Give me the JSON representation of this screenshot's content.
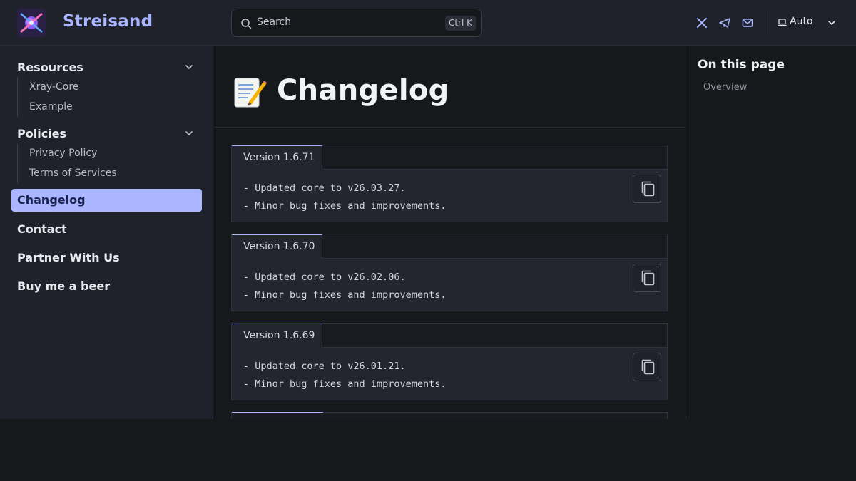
{
  "header": {
    "site_title": "Streisand",
    "search": {
      "placeholder": "Search",
      "shortcut": "Ctrl K"
    },
    "social_icons": [
      "x-icon",
      "telegram-icon",
      "mail-icon"
    ],
    "theme": {
      "label": "Auto",
      "icon": "laptop-icon"
    }
  },
  "sidebar": {
    "groups": [
      {
        "title": "Resources",
        "items": [
          "Xray-Core",
          "Example"
        ]
      },
      {
        "title": "Policies",
        "items": [
          "Privacy Policy",
          "Terms of Services"
        ]
      }
    ],
    "active_item": "Changelog",
    "items": [
      "Contact",
      "Partner With Us",
      "Buy me a beer"
    ]
  },
  "main": {
    "title": "Changelog",
    "title_emoji": "memo-icon",
    "entries": [
      {
        "version": "Version 1.6.71",
        "lines": [
          "- Updated core to v26.03.27.",
          "- Minor bug fixes and improvements."
        ]
      },
      {
        "version": "Version 1.6.70",
        "lines": [
          "- Updated core to v26.02.06.",
          "- Minor bug fixes and improvements."
        ]
      },
      {
        "version": "Version 1.6.69",
        "lines": [
          "- Updated core to v26.01.21.",
          "- Minor bug fixes and improvements."
        ]
      }
    ]
  },
  "aside": {
    "title": "On this page",
    "links": [
      "Overview"
    ]
  },
  "colors": {
    "accent": "#aab6ff",
    "background": "#17181c",
    "panel": "#1f212b"
  }
}
